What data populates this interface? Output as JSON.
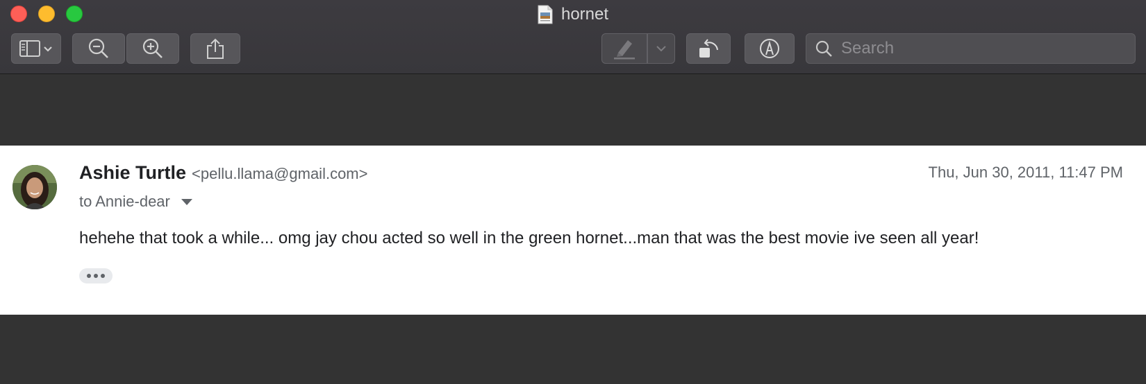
{
  "window": {
    "title": "hornet",
    "doc_icon": "preview-document-icon"
  },
  "toolbar": {
    "sidebar_button": "sidebar-toggle-icon",
    "zoom_out": "zoom-out-icon",
    "zoom_in": "zoom-in-icon",
    "share": "share-icon",
    "highlight": "highlighter-icon",
    "highlight_menu": "chevron-down-icon",
    "rotate": "rotate-icon",
    "markup": "markup-pen-icon",
    "search_placeholder": "Search"
  },
  "email": {
    "sender_name": "Ashie Turtle",
    "sender_email": "<pellu.llama@gmail.com>",
    "date": "Thu, Jun 30, 2011, 11:47 PM",
    "to": "to Annie-dear",
    "body": "hehehe that took a while... omg jay chou acted so well in the green hornet...man that was the best movie ive seen all year!",
    "more_icon": "ellipsis-icon"
  },
  "colors": {
    "titlebar": "#3a393d",
    "canvas": "#333333",
    "close": "#fe5f57",
    "minimize": "#febc2e",
    "maximize": "#28c840"
  }
}
